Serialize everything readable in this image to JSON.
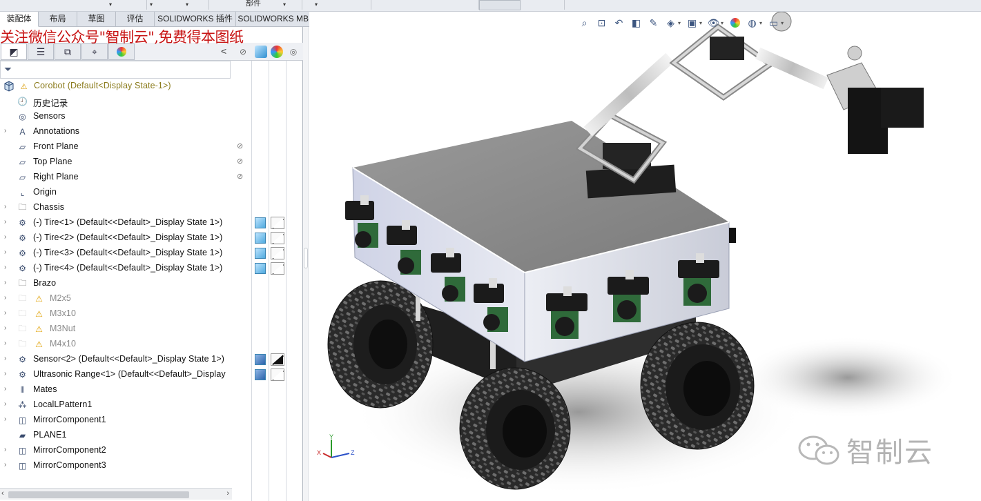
{
  "toolbar_top": {
    "parts_label": "部件"
  },
  "tabs": [
    {
      "label": "装配体",
      "active": true
    },
    {
      "label": "布局"
    },
    {
      "label": "草图"
    },
    {
      "label": "评估"
    },
    {
      "label": "SOLIDWORKS 插件"
    },
    {
      "label": "SOLIDWORKS MBD"
    }
  ],
  "watermark_top": "关注微信公众号\"智制云\",免费得本图纸",
  "panel": {
    "collapse_glyph": "<"
  },
  "tree": {
    "root": {
      "warning": "⚠",
      "label": "Corobot  (Default<Display State-1>)"
    },
    "items": [
      {
        "label": "历史记录",
        "icon": "history-icon",
        "caret": false
      },
      {
        "label": "Sensors",
        "icon": "sensors-icon",
        "caret": false
      },
      {
        "label": "Annotations",
        "icon": "annotations-icon",
        "caret": true
      },
      {
        "label": "Front Plane",
        "icon": "plane-icon",
        "caret": false,
        "hide": true
      },
      {
        "label": "Top Plane",
        "icon": "plane-icon",
        "caret": false,
        "hide": true
      },
      {
        "label": "Right Plane",
        "icon": "plane-icon",
        "caret": false,
        "hide": true
      },
      {
        "label": "Origin",
        "icon": "origin-icon",
        "caret": false
      },
      {
        "label": "Chassis",
        "icon": "folder-icon",
        "caret": true
      },
      {
        "label": "(-) Tire<1> (Default<<Default>_Display State 1>)",
        "icon": "component-icon",
        "caret": true,
        "cube": true,
        "tri": "white"
      },
      {
        "label": "(-) Tire<2> (Default<<Default>_Display State 1>)",
        "icon": "component-icon",
        "caret": true,
        "cube": true,
        "tri": "white"
      },
      {
        "label": "(-) Tire<3> (Default<<Default>_Display State 1>)",
        "icon": "component-icon",
        "caret": true,
        "cube": true,
        "tri": "white"
      },
      {
        "label": "(-) Tire<4> (Default<<Default>_Display State 1>)",
        "icon": "component-icon",
        "caret": true,
        "cube": true,
        "tri": "white"
      },
      {
        "label": "Brazo",
        "icon": "folder-icon",
        "caret": true
      },
      {
        "label": "M2x5",
        "icon": "folder-warning-icon",
        "caret": true,
        "dim": true
      },
      {
        "label": "M3x10",
        "icon": "folder-warning-icon",
        "caret": true,
        "dim": true
      },
      {
        "label": "M3Nut",
        "icon": "folder-warning-icon",
        "caret": true,
        "dim": true
      },
      {
        "label": "M4x10",
        "icon": "folder-warning-icon",
        "caret": true,
        "dim": true
      },
      {
        "label": "Sensor<2> (Default<<Default>_Display State 1>)",
        "icon": "component-icon",
        "caret": true,
        "cube": "dark",
        "tri": "black"
      },
      {
        "label": "Ultrasonic Range<1> (Default<<Default>_Display",
        "icon": "component-icon",
        "caret": true,
        "cube": "dark",
        "tri": "white"
      },
      {
        "label": "Mates",
        "icon": "mates-icon",
        "caret": true
      },
      {
        "label": "LocalLPattern1",
        "icon": "pattern-icon",
        "caret": true
      },
      {
        "label": "MirrorComponent1",
        "icon": "mirror-icon",
        "caret": true
      },
      {
        "label": "PLANE1",
        "icon": "plane1-icon",
        "caret": false
      },
      {
        "label": "MirrorComponent2",
        "icon": "mirror-icon",
        "caret": true
      },
      {
        "label": "MirrorComponent3",
        "icon": "mirror-icon",
        "caret": true
      }
    ]
  },
  "triad": {
    "x": "X",
    "y": "Y",
    "z": "Z"
  },
  "wechat_watermark": "智制云"
}
